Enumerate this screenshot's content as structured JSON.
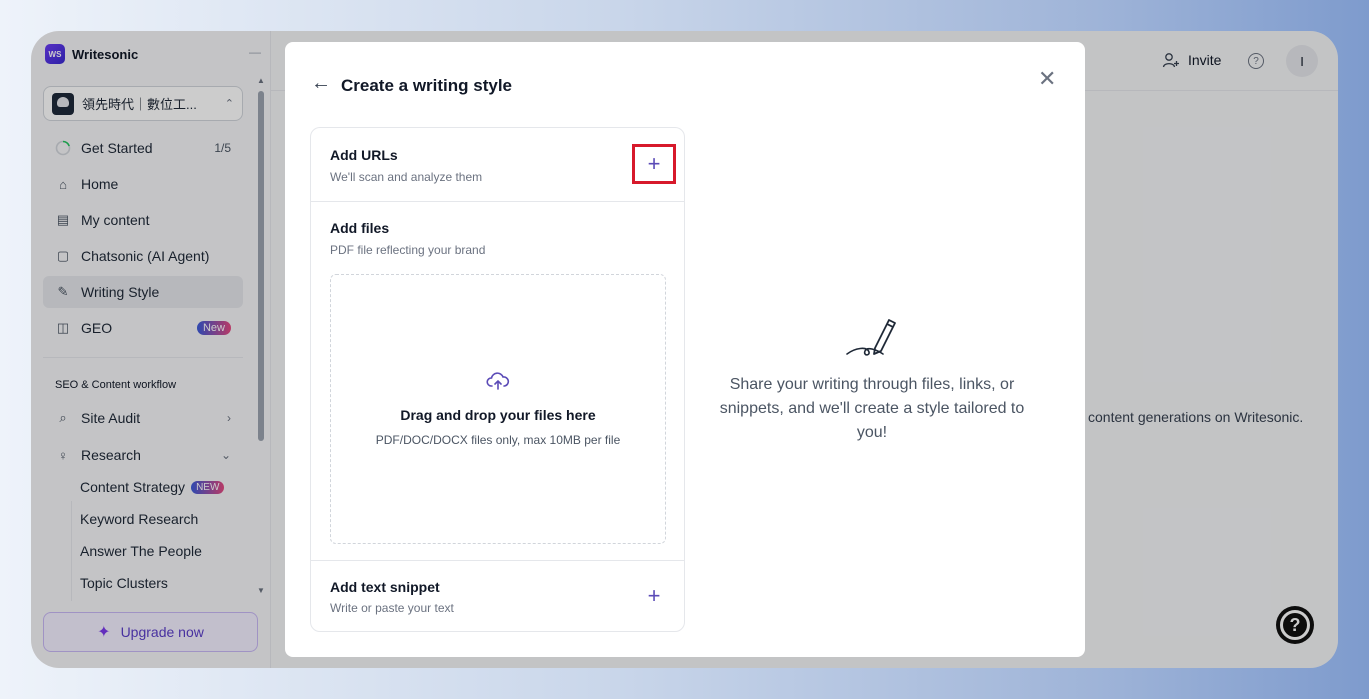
{
  "brand": {
    "name": "Writesonic",
    "logo_text": "WS"
  },
  "workspace": {
    "name": "領先時代｜數位工..."
  },
  "sidebar": {
    "items": [
      {
        "label": "Get Started",
        "count": "1/5",
        "icon": "progress-circle-icon"
      },
      {
        "label": "Home",
        "icon": "home-icon"
      },
      {
        "label": "My content",
        "icon": "document-icon"
      },
      {
        "label": "Chatsonic (AI Agent)",
        "icon": "chatsonic-icon"
      },
      {
        "label": "Writing Style",
        "icon": "feather-icon",
        "active": true
      },
      {
        "label": "GEO",
        "badge": "New",
        "icon": "robot-icon"
      }
    ],
    "section_title": "SEO & Content workflow",
    "seo_items": [
      {
        "label": "Site Audit",
        "icon": "audit-icon"
      },
      {
        "label": "Research",
        "icon": "lightbulb-icon"
      }
    ],
    "research_sub_items": [
      {
        "label": "Content Strategy",
        "badge": "NEW"
      },
      {
        "label": "Keyword Research"
      },
      {
        "label": "Answer The People"
      },
      {
        "label": "Topic Clusters"
      }
    ],
    "upgrade_label": "Upgrade now"
  },
  "topbar": {
    "invite_label": "Invite",
    "user_initial": "I"
  },
  "background_text": "content generations on Writesonic.",
  "modal": {
    "title": "Create a writing style",
    "sections": {
      "urls": {
        "title": "Add URLs",
        "subtitle": "We'll scan and analyze them"
      },
      "files": {
        "title": "Add files",
        "subtitle": "PDF file reflecting your brand",
        "drop_title": "Drag and drop your files here",
        "drop_subtitle": "PDF/DOC/DOCX files only, max 10MB per file"
      },
      "snippet": {
        "title": "Add text snippet",
        "subtitle": "Write or paste your text"
      }
    },
    "empty_state": "Share your writing through files, links, or snippets, and we'll create a style tailored to you!"
  },
  "colors": {
    "accent": "#5b4bb7",
    "highlight": "#d7192b",
    "badge_start": "#3b5bdb",
    "badge_end": "#e64980"
  }
}
